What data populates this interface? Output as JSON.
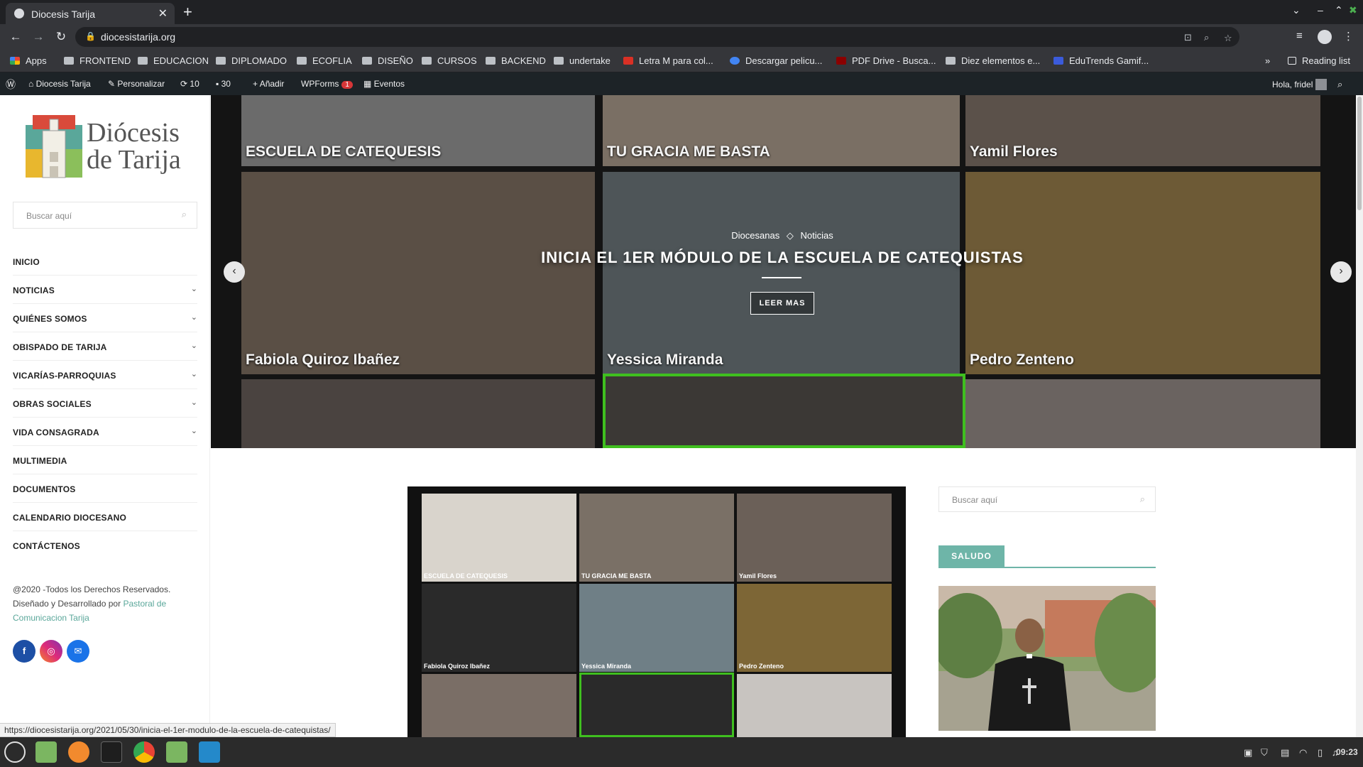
{
  "browser": {
    "tab_title": "Diocesis Tarija",
    "new_tab": "+",
    "url": "diocesistarija.org",
    "status_url": "https://diocesistarija.org/2021/05/30/inicia-el-1er-modulo-de-la-escuela-de-catequistas/",
    "reading_list": "Reading list",
    "bookmarks": [
      {
        "label": "Apps",
        "icon": "apps-icon"
      },
      {
        "label": "FRONTEND",
        "icon": "folder-icon"
      },
      {
        "label": "EDUCACION",
        "icon": "folder-icon"
      },
      {
        "label": "DIPLOMADO",
        "icon": "folder-icon"
      },
      {
        "label": "ECOFLIA",
        "icon": "folder-icon"
      },
      {
        "label": "DISEÑO",
        "icon": "folder-icon"
      },
      {
        "label": "CURSOS",
        "icon": "folder-icon"
      },
      {
        "label": "BACKEND",
        "icon": "folder-icon"
      },
      {
        "label": "undertake",
        "icon": "folder-icon"
      },
      {
        "label": "Letra M para col...",
        "icon": "site-icon"
      },
      {
        "label": "Descargar pelicu...",
        "icon": "site-icon"
      },
      {
        "label": "PDF Drive - Busca...",
        "icon": "site-icon"
      },
      {
        "label": "Diez elementos e...",
        "icon": "site-icon"
      },
      {
        "label": "EduTrends Gamif...",
        "icon": "site-icon"
      }
    ]
  },
  "wp_admin": {
    "site": "Diocesis Tarija",
    "customize": "Personalizar",
    "updates": "10",
    "comments": "30",
    "add_new": "Añadir",
    "wpforms": "WPForms",
    "wpforms_badge": "1",
    "events": "Eventos",
    "greeting": "Hola, fridel"
  },
  "sidebar": {
    "logo_line1": "Diócesis",
    "logo_line2": "de Tarija",
    "search_placeholder": "Buscar aquí",
    "menu": [
      {
        "label": "INICIO",
        "has_children": false
      },
      {
        "label": "NOTICIAS",
        "has_children": true
      },
      {
        "label": "QUIÉNES SOMOS",
        "has_children": true
      },
      {
        "label": "OBISPADO DE TARIJA",
        "has_children": true
      },
      {
        "label": "VICARÍAS-PARROQUIAS",
        "has_children": true
      },
      {
        "label": "OBRAS SOCIALES",
        "has_children": true
      },
      {
        "label": "VIDA CONSAGRADA",
        "has_children": true
      },
      {
        "label": "MULTIMEDIA",
        "has_children": false
      },
      {
        "label": "DOCUMENTOS",
        "has_children": false
      },
      {
        "label": "CALENDARIO DIOCESANO",
        "has_children": false
      },
      {
        "label": "CONTÁCTENOS",
        "has_children": false
      }
    ],
    "copyright_1": "@2020 -Todos los Derechos Reservados.",
    "copyright_2": "Diseñado y Desarrollado por",
    "copyright_link": "Pastoral de Comunicacion Tarija",
    "social": {
      "facebook": "f",
      "instagram": "◎",
      "email": "✉"
    }
  },
  "hero": {
    "category_1": "Diocesanas",
    "category_sep": "◇",
    "category_2": "Noticias",
    "title": "INICIA EL 1ER MÓDULO DE LA ESCUELA DE CATEQUISTAS",
    "button": "LEER MAS",
    "prev": "‹",
    "next": "›",
    "tiles": [
      {
        "name": "ESCUELA DE CATEQUESIS",
        "color": "#6b6b6b"
      },
      {
        "name": "TU GRACIA ME BASTA",
        "color": "#7a6f64"
      },
      {
        "name": "Yamil Flores",
        "color": "#5b514a"
      },
      {
        "name": "Fabiola Quiroz Ibañez",
        "color": "#5a4f45"
      },
      {
        "name": "Yessica Miranda",
        "color": "#4e5558"
      },
      {
        "name": "Pedro Zenteno",
        "color": "#6d5a36"
      },
      {
        "name": "",
        "color": "#4a4340"
      },
      {
        "name": "",
        "color": "#3b3835"
      },
      {
        "name": "",
        "color": "#6a6360"
      }
    ]
  },
  "article": {
    "tiles": [
      {
        "name": "ESCUELA DE CATEQUESIS",
        "color": "#d9d4cc"
      },
      {
        "name": "TU GRACIA ME BASTA",
        "color": "#7a7066"
      },
      {
        "name": "Yamil Flores",
        "color": "#6b6058"
      },
      {
        "name": "Fabiola Quiroz Ibañez",
        "color": "#2a2a2a"
      },
      {
        "name": "Yessica Miranda",
        "color": "#6f7f86"
      },
      {
        "name": "Pedro Zenteno",
        "color": "#7d6636"
      },
      {
        "name": "",
        "color": "#7a6e66"
      },
      {
        "name": "",
        "color": "#2a2a2a"
      },
      {
        "name": "",
        "color": "#c8c4c0"
      }
    ]
  },
  "right_sidebar": {
    "search_placeholder": "Buscar aquí",
    "section_title": "SALUDO"
  },
  "taskbar": {
    "clock": "09:23"
  }
}
